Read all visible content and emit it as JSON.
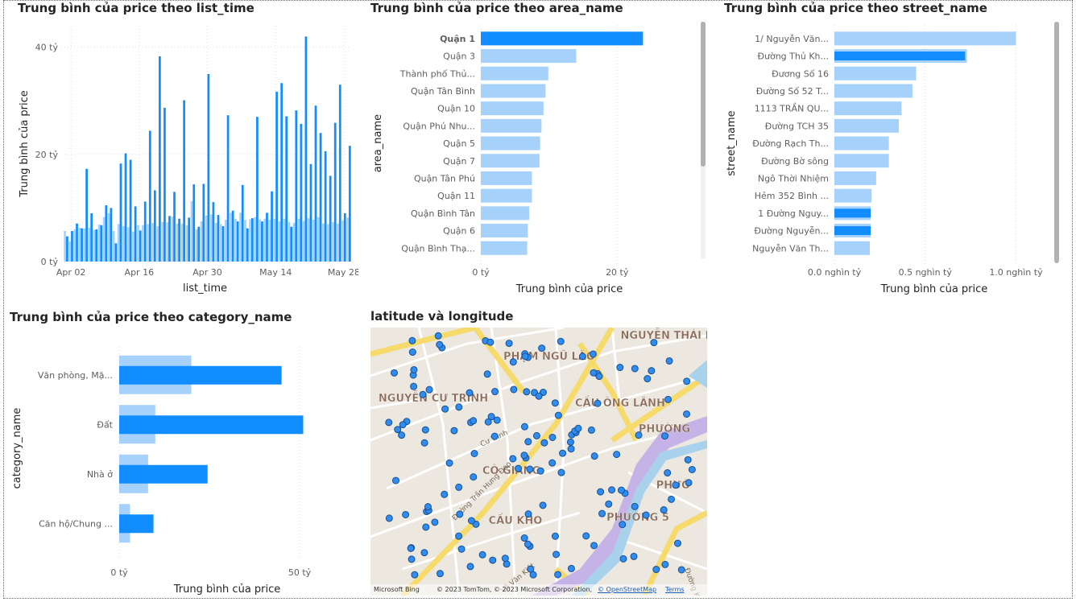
{
  "colors": {
    "dark": "#118dff",
    "light": "#a6d1fa",
    "map_point": "#2f8cf0"
  },
  "visuals": {
    "list_time": {
      "title": "Trung bình của price theo list_time"
    },
    "area": {
      "title": "Trung bình của price theo area_name"
    },
    "street": {
      "title": "Trung bình của price theo street_name"
    },
    "category": {
      "title": "Trung bình của price theo category_name"
    },
    "map": {
      "title": "latitude và longitude",
      "labels": [
        "NGUYỄN THÁI B",
        "PHẠM NGŨ LÃO",
        "NGUYỄN CƯ TRINH",
        "CẦU ÔNG LÃNH",
        "PHƯỜNG",
        "CÔ GIANG",
        "PHƯỜ",
        "CẦU KHO",
        "PHƯỜNG 5"
      ],
      "streets": [
        "Đường Trần Hưng Đạo",
        "Võ Văn Kiệt",
        "Cư Trinh",
        "Đường Khánh"
      ],
      "footer": {
        "logo": "Microsoft Bing",
        "copyright": "© 2023 TomTom, © 2023 Microsoft Corporation,",
        "osm": "© OpenStreetMap",
        "terms": "Terms"
      }
    }
  },
  "chart_data": [
    {
      "type": "bar",
      "title": "Trung bình của price theo list_time",
      "xlabel": "list_time",
      "ylabel": "Trung bình của price",
      "x_ticks": [
        "Apr 02",
        "Apr 16",
        "Apr 30",
        "May 14",
        "May 28"
      ],
      "y_ticks": [
        "0 tỷ",
        "20 tỷ",
        "40 tỷ"
      ],
      "ylim": [
        0,
        44
      ],
      "x_range": [
        "2023-03-31",
        "2023-05-29"
      ],
      "series": [
        {
          "start": "2023-04-01",
          "values": [
            4.7,
            5.7,
            7.1,
            6.2,
            17.3,
            9.0,
            6.0,
            6.8,
            10.5,
            10.0,
            3.4,
            18.3,
            20.2,
            19.0,
            10.3,
            5.8,
            11.2,
            24.4,
            13.3,
            38.3,
            28.7,
            8.5,
            13.0,
            8.0,
            30.1,
            8.2,
            14.4,
            6.5,
            14.5,
            35.0,
            11.1,
            8.7,
            6.6,
            27.3,
            9.5,
            7.5,
            14.3,
            6.2,
            8.1,
            27.0,
            7.5,
            9.1,
            13.1,
            31.7,
            33.3,
            27.1,
            6.5,
            28.2,
            25.7,
            42.0,
            18.2,
            29.1,
            24.0,
            20.6,
            16.0,
            25.9,
            33.0,
            9.0,
            21.6
          ]
        },
        {
          "start": "2023-04-01",
          "values": [
            5.7,
            3.8,
            6.0,
            6.3,
            6.2,
            6.3,
            5.9,
            6.9,
            8.3,
            9.0,
            5.7,
            7.0,
            6.6,
            6.4,
            5.6,
            6.8,
            6.8,
            7.0,
            7.2,
            6.6,
            7.4,
            7.3,
            8.4,
            7.1,
            7.1,
            6.8,
            11.3,
            6.0,
            7.5,
            8.6,
            8.8,
            7.2,
            7.0,
            7.8,
            9.1,
            8.0,
            9.1,
            7.8,
            7.9,
            8.3,
            7.9,
            8.0,
            7.8,
            8.0,
            7.5,
            8.0,
            7.4,
            7.2,
            8.0,
            7.6,
            8.1,
            7.8,
            8.3,
            7.1,
            7.0,
            7.4,
            7.1,
            7.7,
            8.2
          ]
        }
      ]
    },
    {
      "type": "bar",
      "orientation": "horizontal",
      "title": "Trung bình của price theo area_name",
      "xlabel": "Trung bình của price",
      "ylabel": "area_name",
      "x_ticks": [
        "0 tỷ",
        "20 tỷ"
      ],
      "xlim": [
        0,
        26
      ],
      "categories": [
        "Quận 1",
        "Quận 3",
        "Thành phố Thủ...",
        "Quận Tân Bình",
        "Quận 10",
        "Quận Phú Nhu...",
        "Quận 5",
        "Quận 7",
        "Quận Tân Phú",
        "Quận 11",
        "Quận Bình Tân",
        "Quận 6",
        "Quận Bình Thạ..."
      ],
      "values": [
        23.8,
        14.0,
        9.9,
        9.5,
        9.2,
        8.9,
        8.7,
        8.6,
        7.5,
        7.5,
        7.1,
        6.9,
        6.8
      ],
      "highlighted": "Quận 1"
    },
    {
      "type": "bar",
      "orientation": "horizontal",
      "title": "Trung bình của price theo street_name",
      "xlabel": "Trung bình của price",
      "ylabel": "street_name",
      "x_ticks": [
        "0.0 nghìn tỷ",
        "0.5 nghìn tỷ",
        "1.0 nghìn tỷ"
      ],
      "xlim": [
        0,
        1.1
      ],
      "categories": [
        "1/ Nguyễn Văn...",
        "Đường Thủ Kh...",
        "Đương Số 16",
        "Đường Số 52 T...",
        "1113 TRẦN QU...",
        "Đường TCH 35",
        "Đường Rạch Th...",
        "Đường Bờ sông",
        "Ngô Thời Nhiệm",
        "Hẻm 352 Bình ...",
        "1 Đường Nguy...",
        "Đường Nguyễn...",
        "Nguyễn Văn Th..."
      ],
      "values": [
        1.0,
        0.73,
        0.45,
        0.43,
        0.37,
        0.355,
        0.3,
        0.3,
        0.23,
        0.205,
        0.2,
        0.2,
        0.195
      ],
      "highlight": [
        0,
        0.72,
        0,
        0,
        0,
        0,
        0,
        0,
        0,
        0,
        0.2,
        0.2,
        0
      ]
    },
    {
      "type": "bar",
      "orientation": "horizontal",
      "title": "Trung bình của price theo category_name",
      "xlabel": "Trung bình của price",
      "ylabel": "category_name",
      "x_ticks": [
        "0 tỷ",
        "50 tỷ"
      ],
      "xlim": [
        0,
        55
      ],
      "categories": [
        "Văn phòng, Mặ...",
        "Đất",
        "Nhà ở",
        "Căn hộ/Chung ..."
      ],
      "series": [
        {
          "values": [
            20,
            10,
            8,
            3
          ]
        },
        {
          "values": [
            45,
            51,
            24.5,
            9.5
          ]
        }
      ]
    }
  ]
}
